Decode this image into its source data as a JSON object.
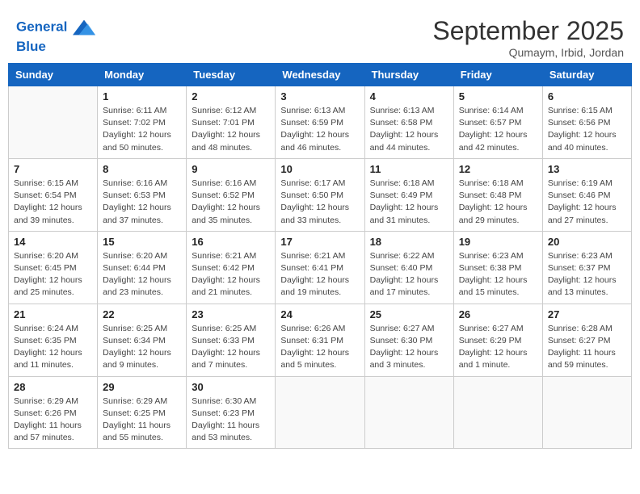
{
  "header": {
    "logo_line1": "General",
    "logo_line2": "Blue",
    "month_title": "September 2025",
    "subtitle": "Qumaym, Irbid, Jordan"
  },
  "weekdays": [
    "Sunday",
    "Monday",
    "Tuesday",
    "Wednesday",
    "Thursday",
    "Friday",
    "Saturday"
  ],
  "weeks": [
    [
      {
        "day": "",
        "info": ""
      },
      {
        "day": "1",
        "info": "Sunrise: 6:11 AM\nSunset: 7:02 PM\nDaylight: 12 hours\nand 50 minutes."
      },
      {
        "day": "2",
        "info": "Sunrise: 6:12 AM\nSunset: 7:01 PM\nDaylight: 12 hours\nand 48 minutes."
      },
      {
        "day": "3",
        "info": "Sunrise: 6:13 AM\nSunset: 6:59 PM\nDaylight: 12 hours\nand 46 minutes."
      },
      {
        "day": "4",
        "info": "Sunrise: 6:13 AM\nSunset: 6:58 PM\nDaylight: 12 hours\nand 44 minutes."
      },
      {
        "day": "5",
        "info": "Sunrise: 6:14 AM\nSunset: 6:57 PM\nDaylight: 12 hours\nand 42 minutes."
      },
      {
        "day": "6",
        "info": "Sunrise: 6:15 AM\nSunset: 6:56 PM\nDaylight: 12 hours\nand 40 minutes."
      }
    ],
    [
      {
        "day": "7",
        "info": "Sunrise: 6:15 AM\nSunset: 6:54 PM\nDaylight: 12 hours\nand 39 minutes."
      },
      {
        "day": "8",
        "info": "Sunrise: 6:16 AM\nSunset: 6:53 PM\nDaylight: 12 hours\nand 37 minutes."
      },
      {
        "day": "9",
        "info": "Sunrise: 6:16 AM\nSunset: 6:52 PM\nDaylight: 12 hours\nand 35 minutes."
      },
      {
        "day": "10",
        "info": "Sunrise: 6:17 AM\nSunset: 6:50 PM\nDaylight: 12 hours\nand 33 minutes."
      },
      {
        "day": "11",
        "info": "Sunrise: 6:18 AM\nSunset: 6:49 PM\nDaylight: 12 hours\nand 31 minutes."
      },
      {
        "day": "12",
        "info": "Sunrise: 6:18 AM\nSunset: 6:48 PM\nDaylight: 12 hours\nand 29 minutes."
      },
      {
        "day": "13",
        "info": "Sunrise: 6:19 AM\nSunset: 6:46 PM\nDaylight: 12 hours\nand 27 minutes."
      }
    ],
    [
      {
        "day": "14",
        "info": "Sunrise: 6:20 AM\nSunset: 6:45 PM\nDaylight: 12 hours\nand 25 minutes."
      },
      {
        "day": "15",
        "info": "Sunrise: 6:20 AM\nSunset: 6:44 PM\nDaylight: 12 hours\nand 23 minutes."
      },
      {
        "day": "16",
        "info": "Sunrise: 6:21 AM\nSunset: 6:42 PM\nDaylight: 12 hours\nand 21 minutes."
      },
      {
        "day": "17",
        "info": "Sunrise: 6:21 AM\nSunset: 6:41 PM\nDaylight: 12 hours\nand 19 minutes."
      },
      {
        "day": "18",
        "info": "Sunrise: 6:22 AM\nSunset: 6:40 PM\nDaylight: 12 hours\nand 17 minutes."
      },
      {
        "day": "19",
        "info": "Sunrise: 6:23 AM\nSunset: 6:38 PM\nDaylight: 12 hours\nand 15 minutes."
      },
      {
        "day": "20",
        "info": "Sunrise: 6:23 AM\nSunset: 6:37 PM\nDaylight: 12 hours\nand 13 minutes."
      }
    ],
    [
      {
        "day": "21",
        "info": "Sunrise: 6:24 AM\nSunset: 6:35 PM\nDaylight: 12 hours\nand 11 minutes."
      },
      {
        "day": "22",
        "info": "Sunrise: 6:25 AM\nSunset: 6:34 PM\nDaylight: 12 hours\nand 9 minutes."
      },
      {
        "day": "23",
        "info": "Sunrise: 6:25 AM\nSunset: 6:33 PM\nDaylight: 12 hours\nand 7 minutes."
      },
      {
        "day": "24",
        "info": "Sunrise: 6:26 AM\nSunset: 6:31 PM\nDaylight: 12 hours\nand 5 minutes."
      },
      {
        "day": "25",
        "info": "Sunrise: 6:27 AM\nSunset: 6:30 PM\nDaylight: 12 hours\nand 3 minutes."
      },
      {
        "day": "26",
        "info": "Sunrise: 6:27 AM\nSunset: 6:29 PM\nDaylight: 12 hours\nand 1 minute."
      },
      {
        "day": "27",
        "info": "Sunrise: 6:28 AM\nSunset: 6:27 PM\nDaylight: 11 hours\nand 59 minutes."
      }
    ],
    [
      {
        "day": "28",
        "info": "Sunrise: 6:29 AM\nSunset: 6:26 PM\nDaylight: 11 hours\nand 57 minutes."
      },
      {
        "day": "29",
        "info": "Sunrise: 6:29 AM\nSunset: 6:25 PM\nDaylight: 11 hours\nand 55 minutes."
      },
      {
        "day": "30",
        "info": "Sunrise: 6:30 AM\nSunset: 6:23 PM\nDaylight: 11 hours\nand 53 minutes."
      },
      {
        "day": "",
        "info": ""
      },
      {
        "day": "",
        "info": ""
      },
      {
        "day": "",
        "info": ""
      },
      {
        "day": "",
        "info": ""
      }
    ]
  ]
}
